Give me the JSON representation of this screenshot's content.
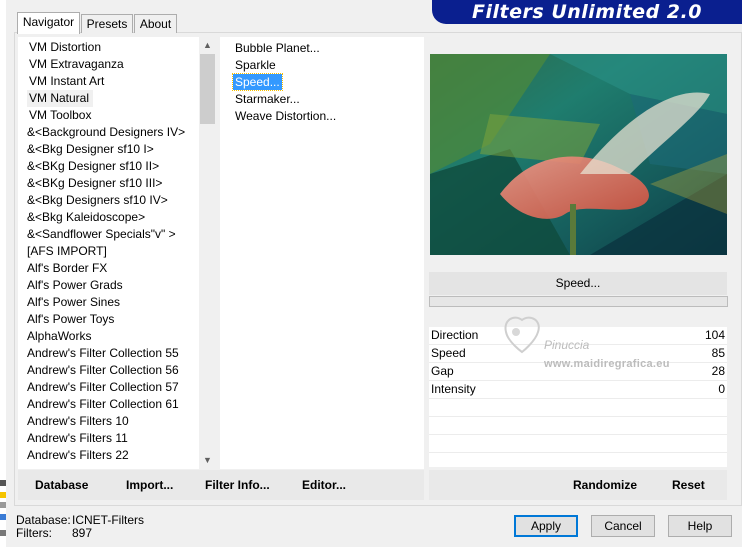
{
  "banner_title": "Filters Unlimited 2.0",
  "tabs": [
    "Navigator",
    "Presets",
    "About"
  ],
  "categories": [
    "VM Distortion",
    "VM Extravaganza",
    "VM Instant Art",
    "VM Natural",
    "VM Toolbox",
    "&<Background Designers IV>",
    "&<Bkg Designer sf10 I>",
    "&<BKg Designer sf10 II>",
    "&<BKg Designer sf10 III>",
    "&<Bkg Designers sf10 IV>",
    "&<Bkg Kaleidoscope>",
    "&<Sandflower Specials\"v\" >",
    "[AFS IMPORT]",
    "Alf's Border FX",
    "Alf's Power Grads",
    "Alf's Power Sines",
    "Alf's Power Toys",
    "AlphaWorks",
    "Andrew's Filter Collection 55",
    "Andrew's Filter Collection 56",
    "Andrew's Filter Collection 57",
    "Andrew's Filter Collection 61",
    "Andrew's Filters 10",
    "Andrew's Filters 11",
    "Andrew's Filters 22"
  ],
  "selected_category": "VM Natural",
  "filters": [
    "Bubble Planet...",
    "Sparkle",
    "Speed...",
    "Starmaker...",
    "Weave Distortion..."
  ],
  "selected_filter": "Speed...",
  "current_filter_label": "Speed...",
  "progress": 0,
  "params": [
    {
      "label": "Direction",
      "value": "104"
    },
    {
      "label": "Speed",
      "value": "85"
    },
    {
      "label": "Gap",
      "value": "28"
    },
    {
      "label": "Intensity",
      "value": "0"
    },
    {
      "label": "",
      "value": ""
    },
    {
      "label": "",
      "value": ""
    },
    {
      "label": "",
      "value": ""
    },
    {
      "label": "",
      "value": ""
    }
  ],
  "watermark": {
    "name": "Pinuccia",
    "url": "www.maidiregrafica.eu"
  },
  "toolbar_left": [
    {
      "name": "database-button",
      "label": "Database"
    },
    {
      "name": "import-button",
      "label": "Import..."
    },
    {
      "name": "filter-info-button",
      "label": "Filter Info..."
    },
    {
      "name": "editor-button",
      "label": "Editor..."
    }
  ],
  "toolbar_right": [
    {
      "name": "randomize-button",
      "label": "Randomize"
    },
    {
      "name": "reset-button",
      "label": "Reset"
    }
  ],
  "status": {
    "database_label": "Database:",
    "database_value": "ICNET-Filters",
    "filters_label": "Filters:",
    "filters_value": "897"
  },
  "dialog_buttons": {
    "apply": "Apply",
    "cancel": "Cancel",
    "help": "Help"
  },
  "colors": {
    "banner": "#0a1f8f",
    "selection": "#3399ff",
    "focus_border": "#0078d7"
  }
}
